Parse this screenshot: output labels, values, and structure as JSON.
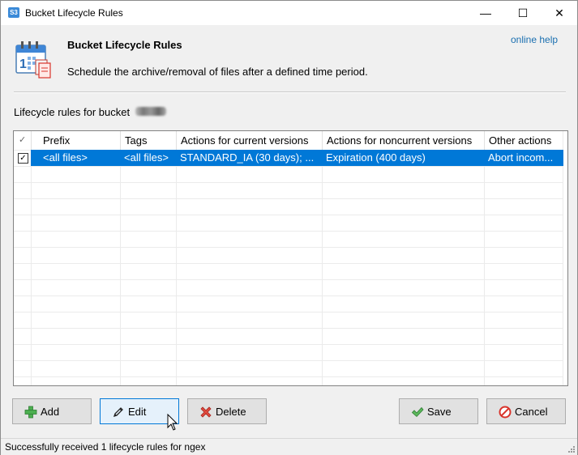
{
  "window": {
    "title": "Bucket Lifecycle Rules",
    "app_icon": "S3",
    "controls": {
      "minimize": "—",
      "maximize": "☐",
      "close": "✕"
    }
  },
  "header": {
    "title": "Bucket Lifecycle Rules",
    "description": "Schedule the archive/removal of files after a defined time period.",
    "online_help": "online help",
    "icon": "calendar-icon"
  },
  "rules_label": "Lifecycle rules for bucket",
  "grid": {
    "columns": [
      {
        "key": "check",
        "label": "✓"
      },
      {
        "key": "prefix",
        "label": "Prefix"
      },
      {
        "key": "tags",
        "label": "Tags"
      },
      {
        "key": "current",
        "label": "Actions for current versions"
      },
      {
        "key": "noncurrent",
        "label": "Actions for noncurrent versions"
      },
      {
        "key": "other",
        "label": "Other actions"
      }
    ],
    "rows": [
      {
        "checked": true,
        "checkmark": "✓",
        "prefix": "<all files>",
        "tags": "<all files>",
        "current": "STANDARD_IA (30 days); ...",
        "noncurrent": "Expiration (400 days)",
        "other": "Abort incom..."
      }
    ],
    "selected_row": 0
  },
  "buttons": {
    "add": {
      "label": "Add",
      "icon": "plus-icon"
    },
    "edit": {
      "label": "Edit",
      "icon": "pencil-icon"
    },
    "delete": {
      "label": "Delete",
      "icon": "delete-x-icon"
    },
    "save": {
      "label": "Save",
      "icon": "checkmark-icon"
    },
    "cancel": {
      "label": "Cancel",
      "icon": "cancel-icon"
    }
  },
  "status": {
    "text": "Successfully received 1 lifecycle rules for ngex"
  },
  "colors": {
    "selection": "#0078d7",
    "link": "#1a6fb0",
    "add_green": "#4caf50",
    "delete_red": "#d9342b",
    "save_green": "#5cb85c",
    "cancel_red": "#d9342b"
  }
}
